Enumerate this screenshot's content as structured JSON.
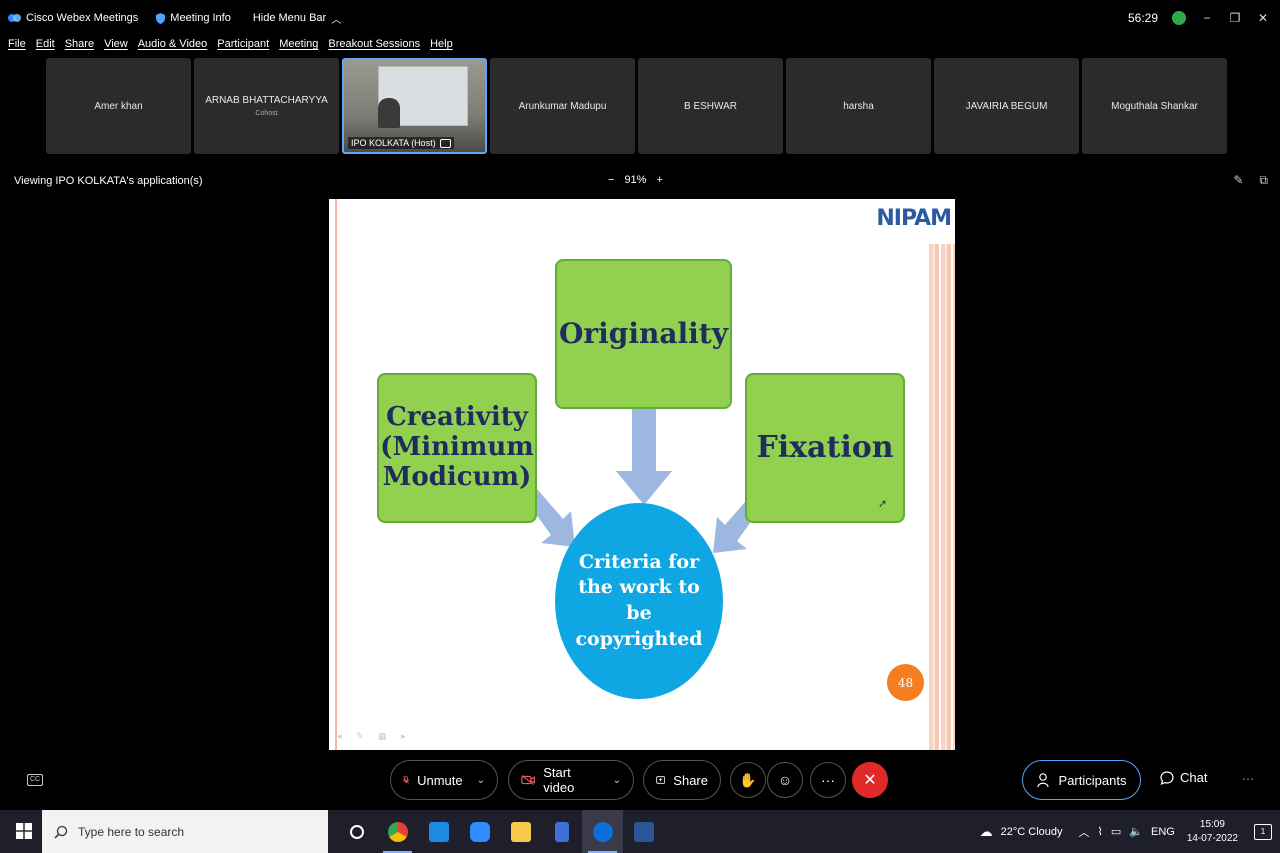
{
  "titlebar": {
    "app_name": "Cisco Webex Meetings",
    "meeting_info": "Meeting Info",
    "hide_menu": "Hide Menu Bar",
    "timer": "56:29"
  },
  "menu": [
    "File",
    "Edit",
    "Share",
    "View",
    "Audio & Video",
    "Participant",
    "Meeting",
    "Breakout Sessions",
    "Help"
  ],
  "participants": [
    {
      "name": "Amer khan",
      "role": ""
    },
    {
      "name": "ARNAB BHATTACHARYYA",
      "role": "Cohost"
    },
    {
      "name": "IPO KOLKATA (Host)",
      "role": "host"
    },
    {
      "name": "Arunkumar Madupu",
      "role": ""
    },
    {
      "name": "B ESHWAR",
      "role": ""
    },
    {
      "name": "harsha",
      "role": ""
    },
    {
      "name": "JAVAIRIA BEGUM",
      "role": ""
    },
    {
      "name": "Moguthala Shankar",
      "role": ""
    }
  ],
  "viewbar": {
    "viewing": "Viewing IPO KOLKATA's application(s)",
    "zoom_minus": "−",
    "zoom": "91%",
    "zoom_plus": "+"
  },
  "slide": {
    "logo": "NIPAM",
    "box_originality": "Originality",
    "box_creativity_1": "Creativity",
    "box_creativity_2": "(Minimum",
    "box_creativity_3": "Modicum)",
    "box_fixation": "Fixation",
    "circle_1": "Criteria for",
    "circle_2": "the work to",
    "circle_3": "be",
    "circle_4": "copyrighted",
    "page_number": "48"
  },
  "controls": {
    "unmute": "Unmute",
    "start_video": "Start video",
    "share": "Share",
    "more": "···",
    "end": "✕",
    "participants": "Participants",
    "chat": "Chat"
  },
  "taskbar": {
    "search_placeholder": "Type here to search",
    "weather": "22°C  Cloudy",
    "lang": "ENG",
    "time": "15:09",
    "date": "14-07-2022",
    "notif_count": "1"
  }
}
